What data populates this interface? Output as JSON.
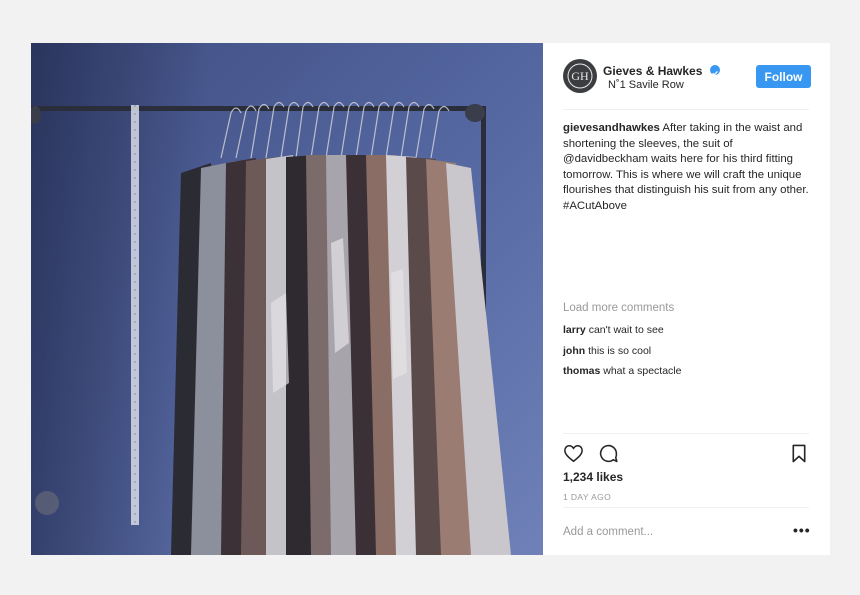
{
  "post": {
    "account_name": "Gieves & Hawkes",
    "avatar_monogram": "GH",
    "location": "N˚1 Savile Row",
    "follow_label": "Follow",
    "caption_user": "gievesandhawkes",
    "caption_text": " After taking in the waist and shortening the sleeves, the suit of @davidbeckham waits here for his third fitting tomorrow. This is where we will craft the unique flourishes that distinguish his suit from any other. #ACutAbove",
    "load_more": "Load more comments",
    "comments": [
      {
        "user": "larry",
        "text": " can't wait to see"
      },
      {
        "user": "john",
        "text": "  this is so cool"
      },
      {
        "user": "thomas",
        "text": " what a spectacle"
      }
    ],
    "likes": "1,234 likes",
    "time": "1 DAY AGO",
    "add_comment_placeholder": "Add a comment...",
    "more_label": "•••"
  },
  "colors": {
    "accent": "#3897f0",
    "photo_wall": "#4a5a8e",
    "muted_text": "#999999"
  },
  "icons": [
    "verified-badge-icon",
    "heart-icon",
    "comment-icon",
    "bookmark-icon",
    "more-options-icon"
  ]
}
